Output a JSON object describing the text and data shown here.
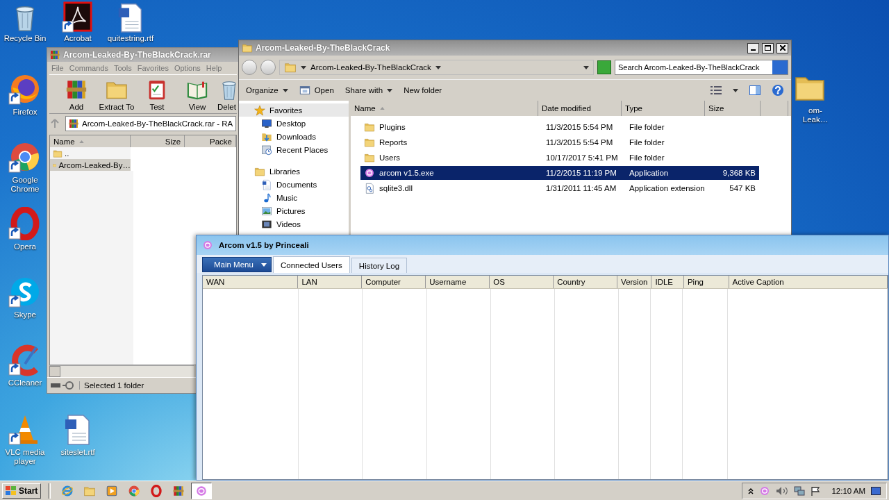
{
  "desktop_icons": [
    {
      "label": "Recycle Bin",
      "kind": "trash",
      "shortcut": false
    },
    {
      "label": "Acrobat",
      "kind": "pdf",
      "shortcut": true
    },
    {
      "label": "quitestring.rtf",
      "kind": "doc",
      "shortcut": false
    },
    {
      "label": "Firefox",
      "kind": "firefox",
      "shortcut": true
    },
    {
      "label": "Google Chrome",
      "kind": "chrome",
      "shortcut": true
    },
    {
      "label": "Opera",
      "kind": "opera",
      "shortcut": true
    },
    {
      "label": "Skype",
      "kind": "skype",
      "shortcut": true
    },
    {
      "label": "CCleaner",
      "kind": "ccleaner",
      "shortcut": true
    },
    {
      "label": "VLC media player",
      "kind": "vlc",
      "shortcut": true
    },
    {
      "label": "siteslet.rtf",
      "kind": "doc",
      "shortcut": false
    },
    {
      "label": "om-Leak…",
      "kind": "folder",
      "shortcut": false
    }
  ],
  "winrar": {
    "title": "Arcom-Leaked-By-TheBlackCrack.rar",
    "menu": [
      "File",
      "Commands",
      "Tools",
      "Favorites",
      "Options",
      "Help"
    ],
    "toolbar": [
      {
        "label": "Add",
        "kind": "archive"
      },
      {
        "label": "Extract To",
        "kind": "folder-open"
      },
      {
        "label": "Test",
        "kind": "clipboard"
      },
      {
        "label": "View",
        "kind": "book"
      },
      {
        "label": "Delet",
        "kind": "trash"
      }
    ],
    "address": "Arcom-Leaked-By-TheBlackCrack.rar - RA",
    "columns": [
      "Name",
      "Size",
      "Packe"
    ],
    "rows": [
      {
        "name": "..",
        "selected": false
      },
      {
        "name": "Arcom-Leaked-By…",
        "selected": true
      }
    ],
    "status": "Selected 1 folder"
  },
  "explorer": {
    "title": "Arcom-Leaked-By-TheBlackCrack",
    "breadcrumb": "Arcom-Leaked-By-TheBlackCrack",
    "search": {
      "placeholder": "Search Arcom-Leaked-By-TheBlackCrack"
    },
    "toolbar": [
      {
        "label": "Organize",
        "kind": "menu"
      },
      {
        "label": "Open",
        "kind": "open"
      },
      {
        "label": "Share with",
        "kind": "menu"
      },
      {
        "label": "New folder",
        "kind": "plain"
      }
    ],
    "nav": [
      {
        "label": "Favorites",
        "kind": "star",
        "selected": true,
        "children": [
          {
            "label": "Desktop",
            "kind": "desktop",
            "selected": false
          },
          {
            "label": "Downloads",
            "kind": "downloads",
            "selected": false
          },
          {
            "label": "Recent Places",
            "kind": "recent",
            "selected": false
          }
        ]
      },
      {
        "label": "Libraries",
        "kind": "library",
        "selected": false,
        "children": [
          {
            "label": "Documents",
            "kind": "documents",
            "selected": false
          },
          {
            "label": "Music",
            "kind": "music",
            "selected": false
          },
          {
            "label": "Pictures",
            "kind": "pictures",
            "selected": false
          },
          {
            "label": "Videos",
            "kind": "videos",
            "selected": false
          }
        ]
      }
    ],
    "columns": [
      "Name",
      "Date modified",
      "Type",
      "Size"
    ],
    "rows": [
      {
        "name": "Plugins",
        "kind": "folder",
        "date": "11/3/2015 5:54 PM",
        "type": "File folder",
        "size": "",
        "selected": false
      },
      {
        "name": "Reports",
        "kind": "folder",
        "date": "11/3/2015 5:54 PM",
        "type": "File folder",
        "size": "",
        "selected": false
      },
      {
        "name": "Users",
        "kind": "folder",
        "date": "10/17/2017 5:41 PM",
        "type": "File folder",
        "size": "",
        "selected": false
      },
      {
        "name": "arcom v1.5.exe",
        "kind": "app",
        "date": "11/2/2015 11:19 PM",
        "type": "Application",
        "size": "9,368 KB",
        "selected": true
      },
      {
        "name": "sqlite3.dll",
        "kind": "dll",
        "date": "1/31/2011 11:45 AM",
        "type": "Application extension",
        "size": "547 KB",
        "selected": false
      }
    ]
  },
  "arcom": {
    "title": "Arcom v1.5 by Princeali",
    "tabs": [
      {
        "label": "Main Menu",
        "kind": "menu",
        "selected": false
      },
      {
        "label": "Connected Users",
        "kind": "tab",
        "selected": true
      },
      {
        "label": "History Log",
        "kind": "tab",
        "selected": false
      }
    ],
    "columns": [
      "WAN",
      "LAN",
      "Computer",
      "Username",
      "OS",
      "Country",
      "Version",
      "IDLE",
      "Ping",
      "Active Caption"
    ]
  },
  "taskbar": {
    "start": "Start",
    "apps": [
      {
        "kind": "ie",
        "selected": false
      },
      {
        "kind": "folder",
        "selected": false
      },
      {
        "kind": "media",
        "selected": false
      },
      {
        "kind": "chrome",
        "selected": false
      },
      {
        "kind": "opera",
        "selected": false
      },
      {
        "kind": "archive",
        "selected": false
      },
      {
        "kind": "app",
        "selected": true
      }
    ],
    "clock": "12:10 AM"
  }
}
